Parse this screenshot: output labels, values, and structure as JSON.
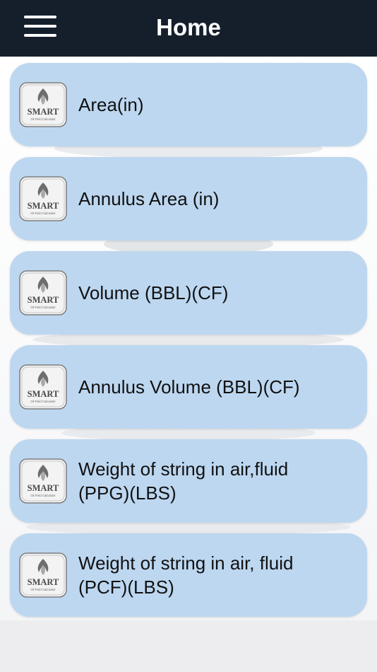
{
  "header": {
    "title": "Home",
    "menu_icon": "hamburger-menu-icon"
  },
  "logo": {
    "brand": "SMART",
    "tagline": "Oil Field Calculator",
    "icon": "flame-logo-icon"
  },
  "colors": {
    "navbar": "#151f2c",
    "card": "#bdd7f0",
    "text": "#111111",
    "background": "#ededf0"
  },
  "items": [
    {
      "label": "Area(in)"
    },
    {
      "label": "Annulus Area (in)"
    },
    {
      "label": "Volume (BBL)(CF)"
    },
    {
      "label": "Annulus Volume (BBL)(CF)"
    },
    {
      "label": "Weight of string in air,fluid\n(PPG)(LBS)"
    },
    {
      "label": "Weight of string in air, fluid\n(PCF)(LBS)"
    }
  ]
}
